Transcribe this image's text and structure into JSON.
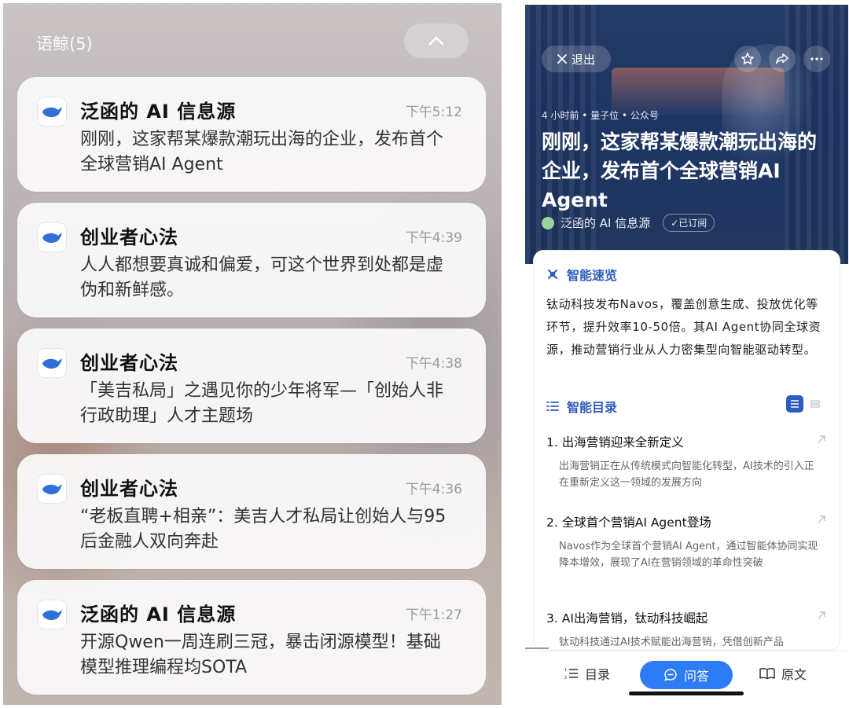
{
  "left": {
    "group_title": "语鲸(5)",
    "notifications": [
      {
        "app": "泛函的 AI 信息源",
        "time": "下午5:12",
        "body": "刚刚，这家帮某爆款潮玩出海的企业，发布首个全球营销AI Agent"
      },
      {
        "app": "创业者心法",
        "time": "下午4:39",
        "body": "人人都想要真诚和偏爱，可这个世界到处都是虚伪和新鲜感。"
      },
      {
        "app": "创业者心法",
        "time": "下午4:38",
        "body": "「美吉私局」之遇见你的少年将军—「创始人非行政助理」人才主题场"
      },
      {
        "app": "创业者心法",
        "time": "下午4:36",
        "body": "“老板直聘+相亲”：美吉人才私局让创始人与95后金融人双向奔赴"
      },
      {
        "app": "泛函的 AI 信息源",
        "time": "下午1:27",
        "body": "开源Qwen一周连刷三冠，暴击闭源模型！基础模型推理编程均SOTA"
      }
    ]
  },
  "right": {
    "exit_label": "退出",
    "meta": "4 小时前 • 量子位 • 公众号",
    "headline": "刚刚，这家帮某爆款潮玩出海的企业，发布首个全球营销AI Agent",
    "source": "泛函的 AI 信息源",
    "subscribed": "✓已订阅",
    "summary_heading": "智能速览",
    "summary": "钛动科技发布Navos，覆盖创意生成、投放优化等环节，提升效率10-50倍。其AI Agent协同全球资源，推动营销行业从人力密集型向智能驱动转型。",
    "toc_heading": "智能目录",
    "toc": [
      {
        "title": "1. 出海营销迎来全新定义",
        "desc": "出海营销正在从传统模式向智能化转型，AI技术的引入正在重新定义这一领域的发展方向"
      },
      {
        "title": "2. 全球首个营销AI Agent登场",
        "desc": "Navos作为全球首个营销AI Agent，通过智能体协同实现降本增效，展现了AI在营销领域的革命性突破"
      },
      {
        "title": "3. AI出海营销，钛动科技崛起",
        "desc": "钛动科技通过AI技术赋能出海营销，凭借创新产品"
      }
    ],
    "bottom": {
      "toc": "目录",
      "qa": "问答",
      "original": "原文"
    }
  },
  "colors": {
    "accent_blue": "#2e7bf6",
    "heading_blue": "#2d5bbf",
    "hero_bg": "#243a66"
  },
  "icons": [
    "whale-app-icon",
    "chevron-up-icon",
    "close-icon",
    "star-icon",
    "share-icon",
    "more-icon",
    "sparkle-icon",
    "list-icon",
    "arrow-up-right-icon",
    "chat-icon",
    "book-icon"
  ]
}
